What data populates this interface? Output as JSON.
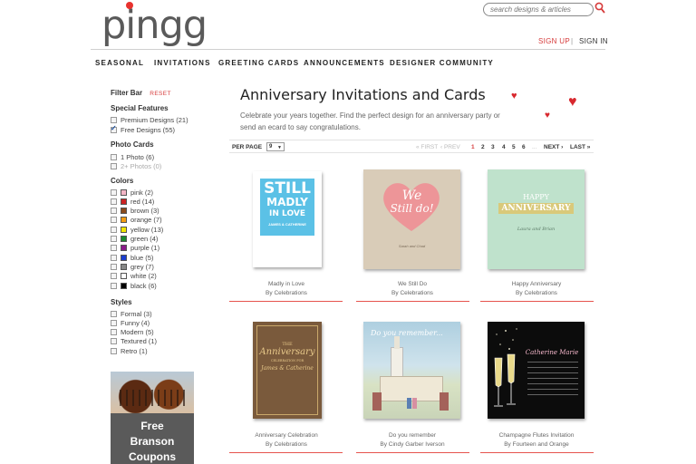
{
  "header": {
    "logo": "pingg",
    "search_placeholder": "search designs & articles",
    "signup": "SIGN UP",
    "separator": "|",
    "signin": "SIGN IN",
    "brand_color": "#d63b3b"
  },
  "nav": [
    "SEASONAL",
    "INVITATIONS",
    "GREETING CARDS",
    "ANNOUNCEMENTS",
    "DESIGNER COMMUNITY"
  ],
  "sidebar": {
    "title": "Filter Bar",
    "reset": "RESET",
    "special_features": {
      "heading": "Special Features",
      "items": [
        {
          "label": "Premium Designs (21)",
          "checked": false
        },
        {
          "label": "Free Designs (55)",
          "checked": true
        }
      ]
    },
    "photo_cards": {
      "heading": "Photo Cards",
      "items": [
        {
          "label": "1 Photo (6)",
          "enabled": true
        },
        {
          "label": "2+ Photos (0)",
          "enabled": false
        }
      ]
    },
    "colors": {
      "heading": "Colors",
      "items": [
        {
          "label": "pink (2)",
          "color": "#f3b6c6"
        },
        {
          "label": "red (14)",
          "color": "#cc2222"
        },
        {
          "label": "brown (3)",
          "color": "#8a4b1c"
        },
        {
          "label": "orange (7)",
          "color": "#f39c12"
        },
        {
          "label": "yellow (13)",
          "color": "#f2e600"
        },
        {
          "label": "green (4)",
          "color": "#1b8a2e"
        },
        {
          "label": "purple (1)",
          "color": "#8a1c8a"
        },
        {
          "label": "blue (5)",
          "color": "#1c3fd0"
        },
        {
          "label": "grey (7)",
          "color": "#888888"
        },
        {
          "label": "white (2)",
          "color": "#ffffff"
        },
        {
          "label": "black (6)",
          "color": "#000000"
        }
      ]
    },
    "styles": {
      "heading": "Styles",
      "items": [
        {
          "label": "Formal (3)"
        },
        {
          "label": "Funny (4)"
        },
        {
          "label": "Modern (5)"
        },
        {
          "label": "Textured (1)"
        },
        {
          "label": "Retro (1)"
        }
      ]
    },
    "ad": {
      "line1": "Free",
      "line2": "Branson",
      "line3": "Coupons"
    }
  },
  "main": {
    "title": "Anniversary Invitations and Cards",
    "description": "Celebrate your years together. Find the perfect design for an anniversary party or send an ecard to say congratulations.",
    "pager": {
      "per_page_label": "PER PAGE",
      "per_page_value": "9",
      "first": "« FIRST",
      "prev": "‹ PREV",
      "pages": [
        "1",
        "2",
        "3",
        "4",
        "5",
        "6"
      ],
      "current": "1",
      "ellipsis": "...",
      "next": "NEXT ›",
      "last": "LAST »"
    },
    "cards": [
      {
        "title": "Madly in Love",
        "author": "By Celebrations"
      },
      {
        "title": "We Still Do",
        "author": "By Celebrations"
      },
      {
        "title": "Happy Anniversary",
        "author": "By Celebrations"
      },
      {
        "title": "Anniversary Celebration",
        "author": "By Celebrations"
      },
      {
        "title": "Do you remember",
        "author": "By Cindy Garber Iverson"
      },
      {
        "title": "Champagne Flutes Invitation",
        "author": "By Fourteen and Orange"
      }
    ],
    "card_art": {
      "madly": {
        "l1": "STILL",
        "l2": "MADLY",
        "l3": "IN LOVE",
        "names": "JAMES & CATHERINE"
      },
      "stilldo": {
        "l1": "We",
        "l2": "Still do!",
        "names": "Sarah and Chad"
      },
      "happy": {
        "l1": "HAPPY",
        "l2": "ANNIVERSARY",
        "names": "Laura and Brian"
      },
      "anniv": {
        "l1": "THE",
        "l2": "Anniversary",
        "l3": "CELEBRATION FOR",
        "names": "James & Catherine"
      },
      "remember": {
        "l1": "Do you remember..."
      },
      "champagne": {
        "names": "Catherine Marie"
      }
    }
  }
}
